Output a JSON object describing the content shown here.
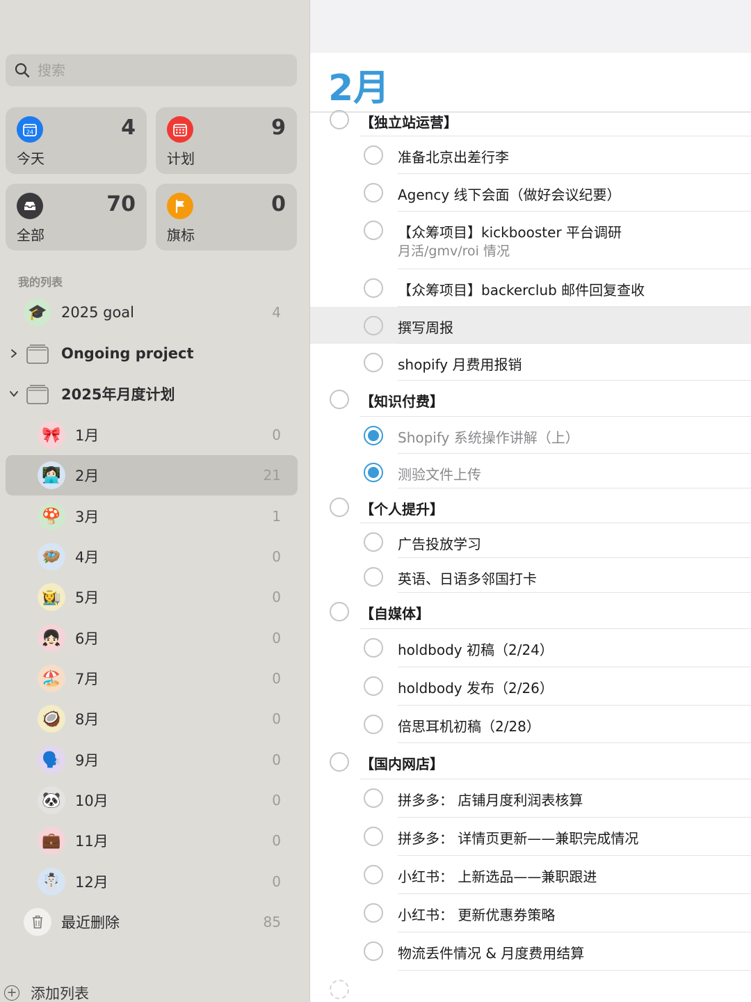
{
  "search": {
    "placeholder": "搜索"
  },
  "smart_lists": [
    {
      "label": "今天",
      "count": "4",
      "icon": "calendar-today-icon",
      "color": "#1d7bf0"
    },
    {
      "label": "计划",
      "count": "9",
      "icon": "calendar-scheduled-icon",
      "color": "#ef3a34"
    },
    {
      "label": "全部",
      "count": "70",
      "icon": "tray-icon",
      "color": "#3a3a3c"
    },
    {
      "label": "旗标",
      "count": "0",
      "icon": "flag-icon",
      "color": "#f59a0c"
    }
  ],
  "today_icon_text": "24",
  "sidebar": {
    "section_title": "我的列表",
    "lists": [
      {
        "name": "2025 goal",
        "count": "4",
        "emoji": "🎓"
      },
      {
        "name": "Ongoing project",
        "type": "group",
        "expanded": false
      },
      {
        "name": "2025年月度计划",
        "type": "group",
        "expanded": true
      },
      {
        "name": "1月",
        "count": "0",
        "emoji": "🎀"
      },
      {
        "name": "2月",
        "count": "21",
        "emoji": "👩🏻‍💻",
        "selected": true
      },
      {
        "name": "3月",
        "count": "1",
        "emoji": "🍄"
      },
      {
        "name": "4月",
        "count": "0",
        "emoji": "🪺"
      },
      {
        "name": "5月",
        "count": "0",
        "emoji": "👩‍🌾"
      },
      {
        "name": "6月",
        "count": "0",
        "emoji": "👧🏻"
      },
      {
        "name": "7月",
        "count": "0",
        "emoji": "🏖️"
      },
      {
        "name": "8月",
        "count": "0",
        "emoji": "🥥"
      },
      {
        "name": "9月",
        "count": "0",
        "emoji": "🗣️"
      },
      {
        "name": "10月",
        "count": "0",
        "emoji": "🐼"
      },
      {
        "name": "11月",
        "count": "0",
        "emoji": "💼"
      },
      {
        "name": "12月",
        "count": "0",
        "emoji": "☃️"
      }
    ],
    "recently_deleted": {
      "name": "最近删除",
      "count": "85"
    },
    "add_list_label": "添加列表"
  },
  "main": {
    "title": "2月",
    "title_color": "#3b9ad8",
    "tasks": [
      {
        "text": "【独立站运营】",
        "level": 0,
        "done": false
      },
      {
        "text": "准备北京出差行李",
        "level": 1,
        "done": false
      },
      {
        "text": "Agency 线下会面（做好会议纪要）",
        "level": 1,
        "done": false
      },
      {
        "text": "【众筹项目】kickbooster 平台调研",
        "note": "月活/gmv/roi 情况",
        "level": 1,
        "done": false
      },
      {
        "text": "【众筹项目】backerclub 邮件回复查收",
        "level": 1,
        "done": false
      },
      {
        "text": "撰写周报",
        "level": 1,
        "done": false,
        "highlight": true
      },
      {
        "text": "shopify 月费用报销",
        "level": 1,
        "done": false
      },
      {
        "text": "【知识付费】",
        "level": 0,
        "done": false
      },
      {
        "text": "Shopify 系统操作讲解（上）",
        "level": 1,
        "done": true
      },
      {
        "text": "测验文件上传",
        "level": 1,
        "done": true
      },
      {
        "text": "【个人提升】",
        "level": 0,
        "done": false
      },
      {
        "text": "广告投放学习",
        "level": 1,
        "done": false
      },
      {
        "text": "英语、日语多邻国打卡",
        "level": 1,
        "done": false
      },
      {
        "text": "【自媒体】",
        "level": 0,
        "done": false
      },
      {
        "text": "holdbody 初稿（2/24）",
        "level": 1,
        "done": false
      },
      {
        "text": "holdbody 发布（2/26）",
        "level": 1,
        "done": false
      },
      {
        "text": "倍思耳机初稿（2/28）",
        "level": 1,
        "done": false
      },
      {
        "text": "【国内网店】",
        "level": 0,
        "done": false
      },
      {
        "text": "拼多多：  店铺月度利润表核算",
        "level": 1,
        "done": false
      },
      {
        "text": "拼多多：  详情页更新——兼职完成情况",
        "level": 1,
        "done": false
      },
      {
        "text": "小红书：  上新选品——兼职跟进",
        "level": 1,
        "done": false
      },
      {
        "text": "小红书：  更新优惠券策略",
        "level": 1,
        "done": false
      },
      {
        "text": "物流丢件情况 & 月度费用结算",
        "level": 1,
        "done": false
      }
    ]
  }
}
